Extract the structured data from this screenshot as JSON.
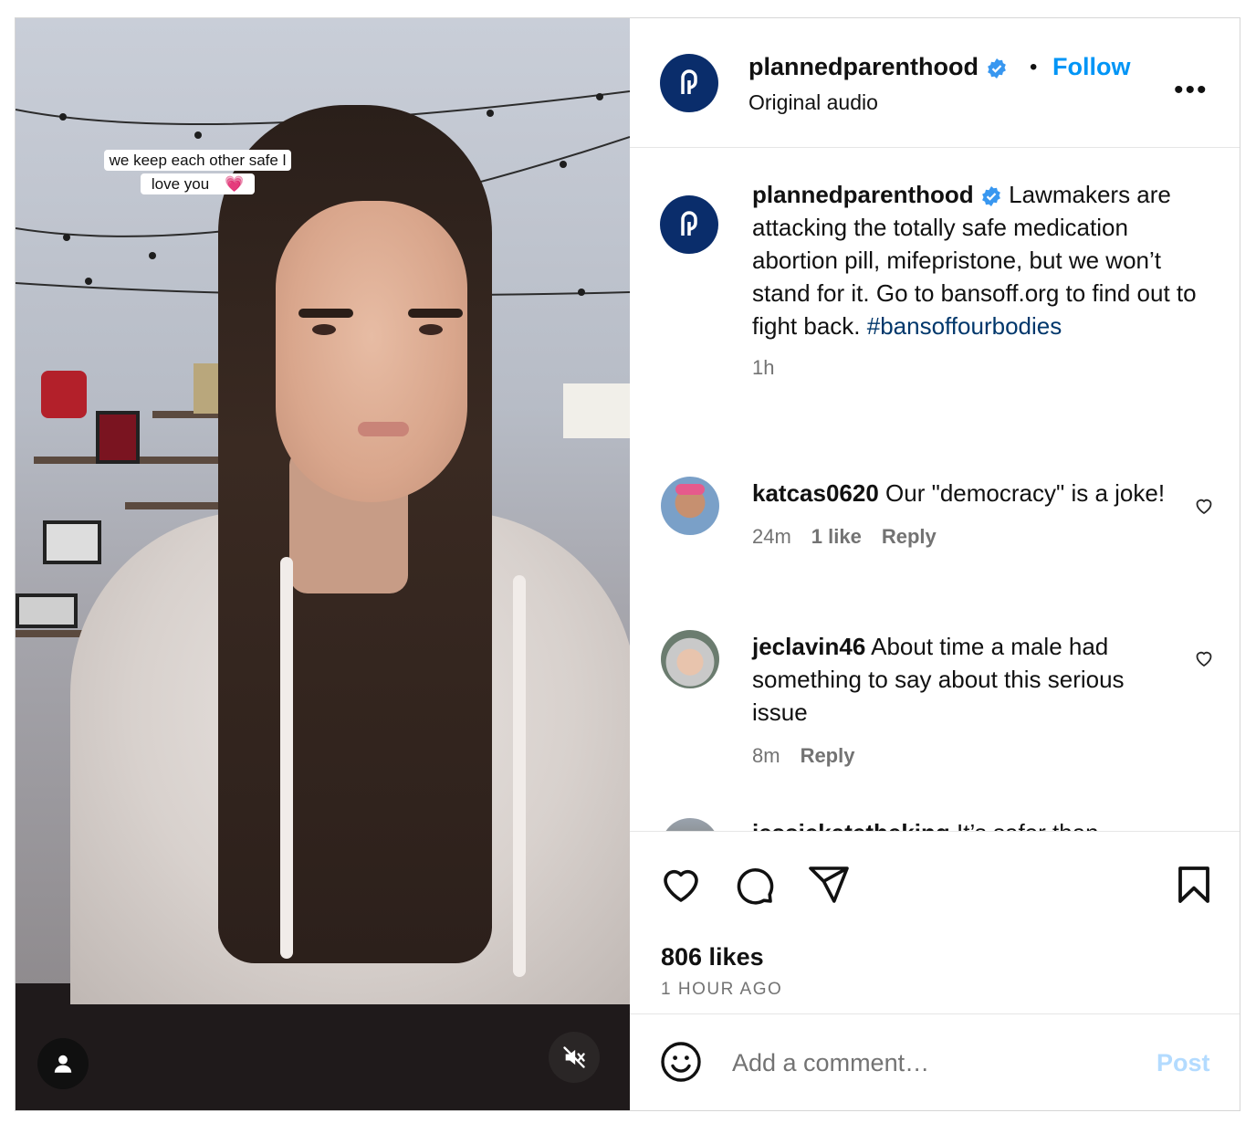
{
  "video": {
    "caption_line1": "we keep each other safe l",
    "caption_line2": "love you",
    "caption_emoji": "💗",
    "user_icon": "user-icon",
    "mute_icon": "muted-speaker-icon"
  },
  "header": {
    "username": "plannedparenthood",
    "separator": "•",
    "follow_label": "Follow",
    "subtitle": "Original audio",
    "more_label": "•••"
  },
  "caption": {
    "username": "plannedparenthood",
    "text": "Lawmakers are attacking the totally safe medication abortion pill, mifepristone, but we won’t stand for it. Go to bansoff.org to find out to fight back.",
    "hashtag": "#bansoffourbodies",
    "time": "1h"
  },
  "comments": [
    {
      "username": "katcas0620",
      "text": "Our \"democracy\" is a joke!",
      "time": "24m",
      "likes": "1 like",
      "reply": "Reply"
    },
    {
      "username": "jeclavin46",
      "text": "About time a male had something to say about this serious issue",
      "time": "8m",
      "reply": "Reply"
    },
    {
      "username": "jessiekatetheking",
      "text": "It’s safer than"
    }
  ],
  "footer": {
    "likes": "806 likes",
    "ago": "1 HOUR AGO",
    "comment_placeholder": "Add a comment…",
    "post_label": "Post"
  },
  "colors": {
    "accent": "#0095f6",
    "hashtag": "#00376b",
    "brand": "#0a2d6b",
    "muted": "#737373"
  }
}
